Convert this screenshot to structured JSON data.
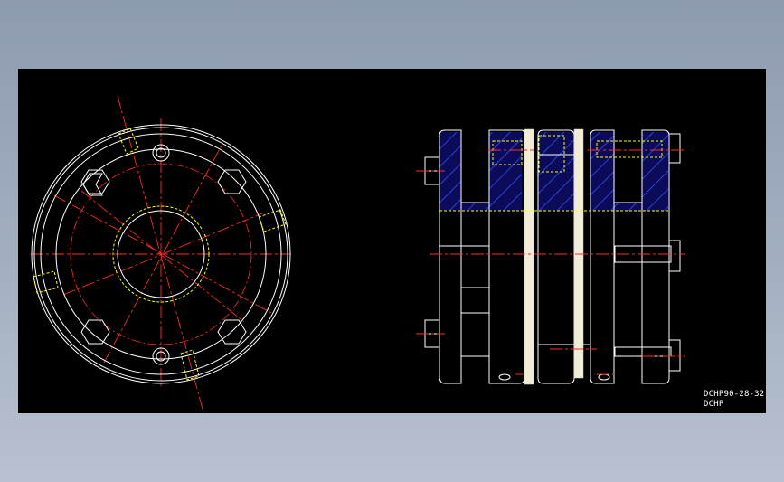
{
  "drawing": {
    "title_line1": "DCHP90-28-32",
    "title_line2": "DCHP",
    "colors": {
      "outline": "#ffffff",
      "centerline": "#ff2a2a",
      "hidden": "#ffff00",
      "hatch_fill": "#0b0b5a",
      "hatch_line": "#3b5bff",
      "disc": "#f0ecd8",
      "page_bg": "#9aa6b8",
      "viewport_bg": "#000000"
    }
  }
}
